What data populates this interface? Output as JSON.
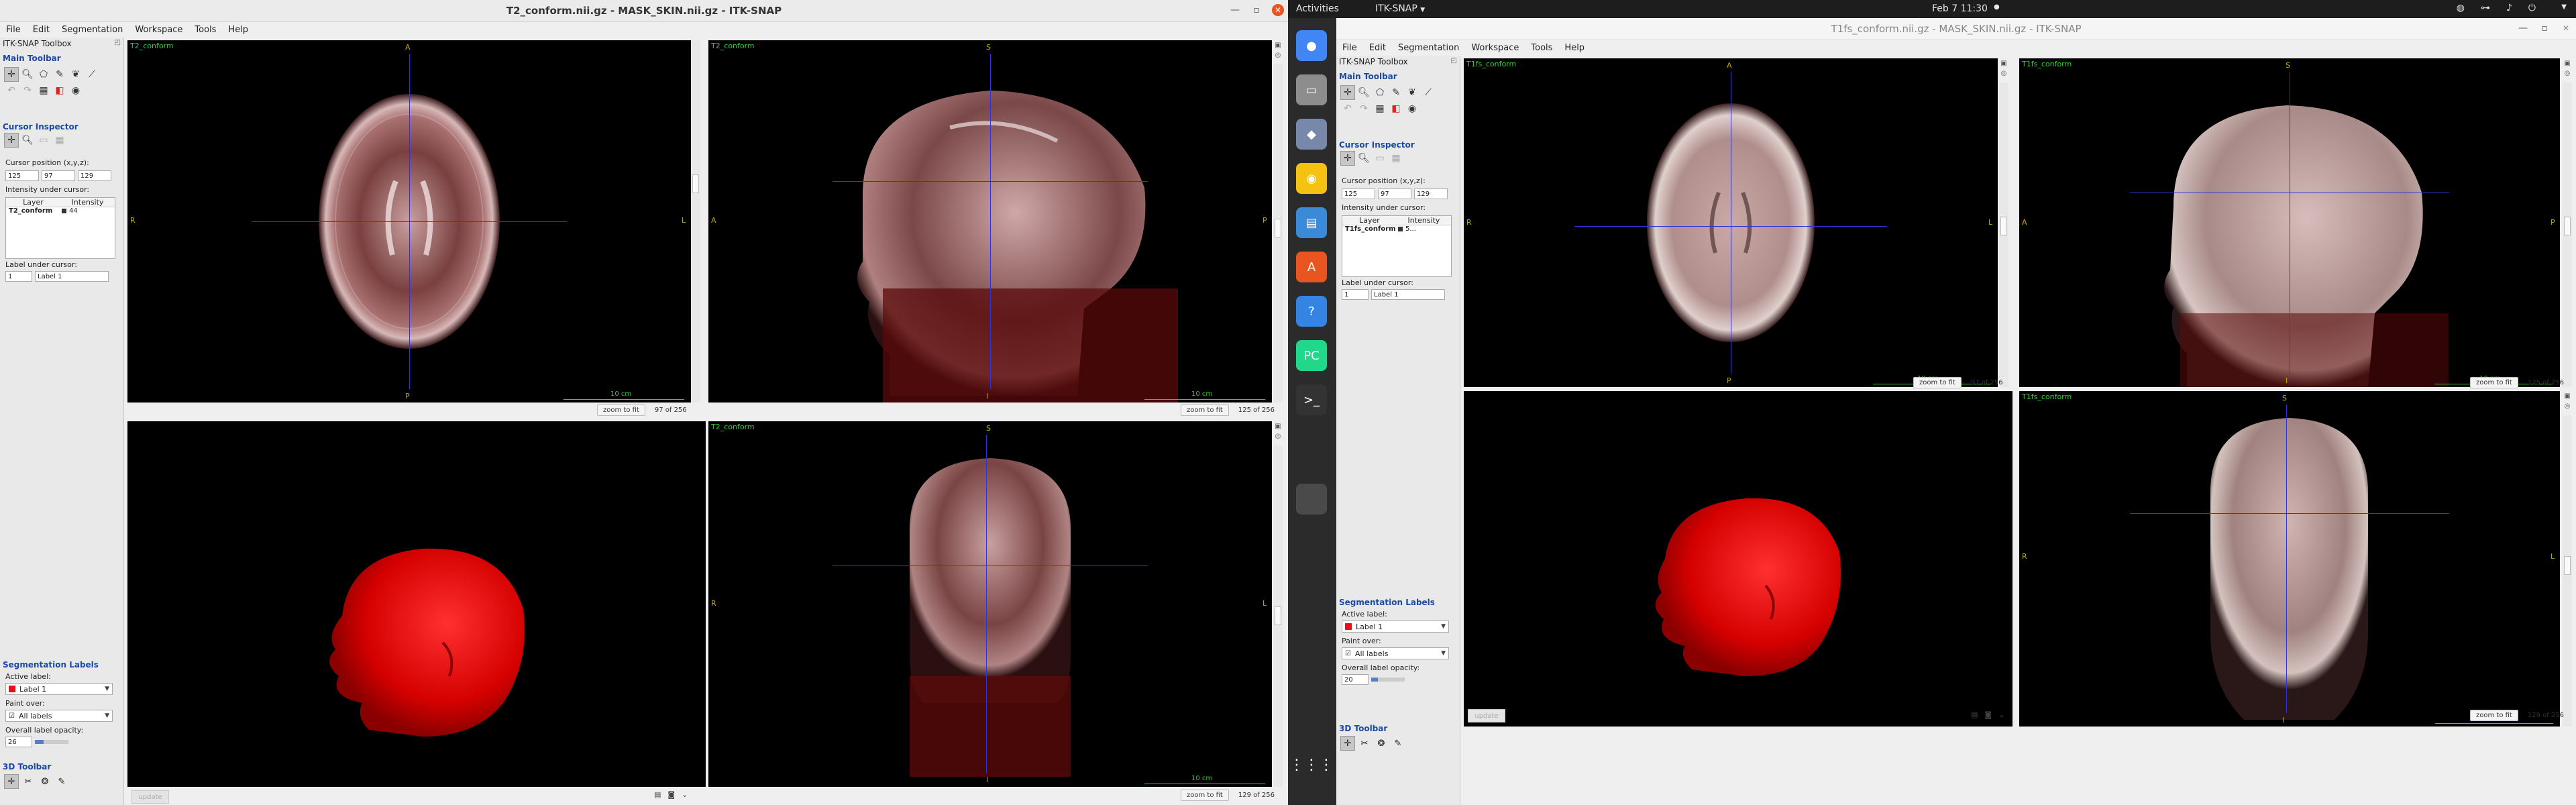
{
  "left_window": {
    "title": "T2_conform.nii.gz - MASK_SKIN.nii.gz - ITK-SNAP",
    "menu": [
      "File",
      "Edit",
      "Segmentation",
      "Workspace",
      "Tools",
      "Help"
    ],
    "toolbox_title": "ITK-SNAP Toolbox",
    "main_toolbar": "Main Toolbar",
    "cursor_inspector": "Cursor Inspector",
    "cursor_position_label": "Cursor position (x,y,z):",
    "cursor": [
      "125",
      "97",
      "129"
    ],
    "intensity_label": "Intensity under cursor:",
    "layer_header": "Layer",
    "intensity_header": "Intensity",
    "layer_name": "T2_conform",
    "layer_value": "44",
    "label_under_cursor": "Label under cursor:",
    "label_id": "1",
    "label_name": "Label 1",
    "seg_labels": "Segmentation Labels",
    "active_label_lbl": "Active label:",
    "active_label": "Label 1",
    "paint_over_lbl": "Paint over:",
    "paint_over": "All labels",
    "opacity_lbl": "Overall label opacity:",
    "opacity": "26",
    "toolbar3d": "3D Toolbar",
    "update": "update",
    "views": {
      "axial": {
        "title": "T2_conform",
        "slice": "97 of 256"
      },
      "sagittal": {
        "title": "T2_conform",
        "slice": "125 of 256"
      },
      "coronal": {
        "title": "T2_conform",
        "slice": "129 of 256"
      }
    }
  },
  "right_window": {
    "title": "T1fs_conform.nii.gz - MASK_SKIN.nii.gz - ITK-SNAP",
    "menu": [
      "File",
      "Edit",
      "Segmentation",
      "Workspace",
      "Tools",
      "Help"
    ],
    "toolbox_title": "ITK-SNAP Toolbox",
    "main_toolbar": "Main Toolbar",
    "cursor_inspector": "Cursor Inspector",
    "cursor_position_label": "Cursor position (x,y,z):",
    "cursor": [
      "125",
      "97",
      "129"
    ],
    "intensity_label": "Intensity under cursor:",
    "layer_header": "Layer",
    "intensity_header": "Intensity",
    "layer_name": "T1fs_conform",
    "layer_value": "5...",
    "label_under_cursor": "Label under cursor:",
    "label_id": "1",
    "label_name": "Label 1",
    "seg_labels": "Segmentation Labels",
    "active_label_lbl": "Active label:",
    "active_label": "Label 1",
    "paint_over_lbl": "Paint over:",
    "paint_over": "All labels",
    "opacity_lbl": "Overall label opacity:",
    "opacity": "20",
    "toolbar3d": "3D Toolbar",
    "update": "update",
    "views": {
      "axial": {
        "title": "T1fs_conform",
        "slice": "97 of 256"
      },
      "sagittal": {
        "title": "T1fs_conform",
        "slice": "125 of 256"
      },
      "coronal": {
        "title": "T1fs_conform",
        "slice": "129 of 256"
      }
    }
  },
  "common": {
    "zoom_to_fit": "zoom to fit",
    "scale_bar": "10 cm",
    "ori": {
      "A": "A",
      "P": "P",
      "R": "R",
      "L": "L",
      "S": "S",
      "I": "I"
    }
  },
  "topbar": {
    "activities": "Activities",
    "app": "ITK-SNAP",
    "clock": "Feb 7  11:30"
  },
  "dock": [
    {
      "name": "chrome-icon",
      "glyph": "●",
      "color": "#4285f4"
    },
    {
      "name": "files-icon",
      "glyph": "▭",
      "color": "#8d8d8d"
    },
    {
      "name": "itksnap-icon",
      "glyph": "◆",
      "color": "#7788aa"
    },
    {
      "name": "rhythmbox-icon",
      "glyph": "◉",
      "color": "#f5c211"
    },
    {
      "name": "writer-icon",
      "glyph": "▤",
      "color": "#3a8ad8"
    },
    {
      "name": "software-icon",
      "glyph": "A",
      "color": "#e95420"
    },
    {
      "name": "help-icon",
      "glyph": "?",
      "color": "#3584e4"
    },
    {
      "name": "pycharm-icon",
      "glyph": "PC",
      "color": "#21d789"
    },
    {
      "name": "terminal-icon",
      "glyph": ">_",
      "color": "#333333"
    }
  ],
  "colors": {
    "label_red": "#e4111a",
    "crosshair": "#3232d8",
    "annot_green": "#33cc33",
    "ori_yellow": "#c8a800",
    "ubuntu_orange": "#e95420"
  }
}
